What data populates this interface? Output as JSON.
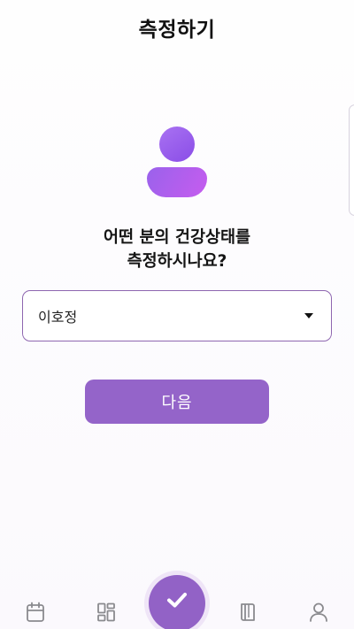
{
  "header": {
    "title": "측정하기"
  },
  "prompt": {
    "line1": "어떤 분의 건강상태를",
    "line2": "측정하시나요?"
  },
  "person_select": {
    "selected": "이호정"
  },
  "next_button": {
    "label": "다음"
  },
  "tabbar": {
    "items": [
      {
        "icon": "calendar-icon"
      },
      {
        "icon": "dashboard-grid-icon"
      },
      {
        "icon": "checkmark-icon",
        "active": true
      },
      {
        "icon": "book-icon"
      },
      {
        "icon": "profile-icon"
      }
    ]
  },
  "colors": {
    "accent": "#9464c9",
    "select_border": "#8e66b0",
    "avatar_head": "#8a4de7",
    "avatar_body": "#c65cee",
    "icon_gray": "#8a8a8e"
  }
}
